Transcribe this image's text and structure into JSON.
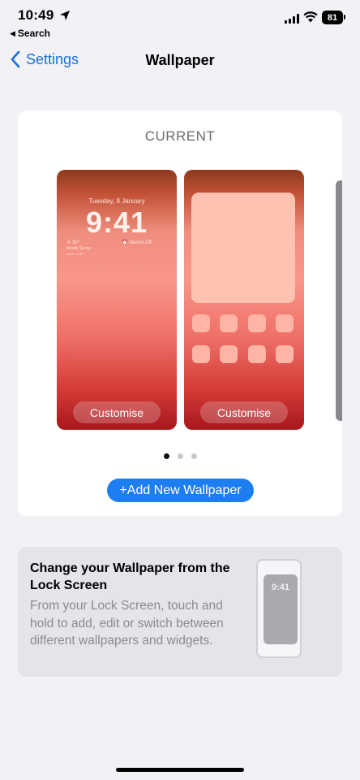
{
  "status_bar": {
    "time": "10:49",
    "back_app": "Search",
    "battery": "81"
  },
  "nav": {
    "back_label": "Settings",
    "title": "Wallpaper"
  },
  "current": {
    "label": "CURRENT",
    "lock_screen": {
      "date": "Tuesday, 9 January",
      "time": "9:41",
      "widget_weather": "☀ 30°",
      "widget_condition": "Mostly Sunny",
      "widget_range": "H:34° L:20°",
      "widget_alarm": "⏰ Alarms Off",
      "button": "Customise"
    },
    "home_screen": {
      "button": "Customise"
    },
    "page_dots": {
      "total": 3,
      "active": 0
    },
    "add_button": "+Add New Wallpaper"
  },
  "info": {
    "title": "Change your Wallpaper from the Lock Screen",
    "text": "From your Lock Screen, touch and hold to add, edit or switch between different wallpapers and widgets.",
    "mini_time": "9:41"
  },
  "colors": {
    "accent": "#1c7ef1",
    "link": "#1d6fd6",
    "background": "#f1f1f6"
  }
}
